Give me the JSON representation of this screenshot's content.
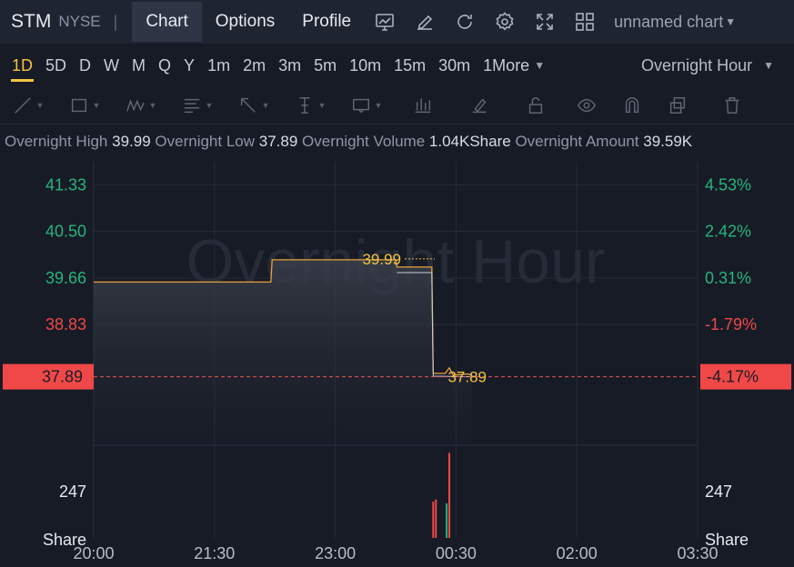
{
  "header": {
    "ticker": "STM",
    "exchange": "NYSE",
    "separator": "|",
    "tabs": [
      {
        "label": "Chart",
        "active": true
      },
      {
        "label": "Options",
        "active": false
      },
      {
        "label": "Profile",
        "active": false
      }
    ],
    "tools": [
      "indicator-icon",
      "draw-pencil-icon",
      "refresh-icon",
      "gear-icon",
      "fullscreen-icon",
      "layout-grid-icon"
    ],
    "chart_name": "unnamed chart"
  },
  "periods": {
    "items": [
      "1D",
      "5D",
      "D",
      "W",
      "M",
      "Q",
      "Y",
      "1m",
      "2m",
      "3m",
      "5m",
      "10m",
      "15m",
      "30m",
      "1More"
    ],
    "active": "1D",
    "session": "Overnight Hour"
  },
  "drawing_tools": [
    "trend-line-icon",
    "rectangle-icon",
    "pattern-icon",
    "fib-icon",
    "arrow-icon",
    "vertical-line-icon",
    "text-note-icon",
    "bars-pattern-icon",
    "brush-icon",
    "lock-icon",
    "eye-icon",
    "magnet-icon",
    "copy-icon",
    "trash-icon"
  ],
  "info": {
    "high_label": "Overnight High",
    "high_value": "39.99",
    "low_label": "Overnight Low",
    "low_value": "37.89",
    "volume_label": "Overnight Volume",
    "volume_value": "1.04KShare",
    "amount_label": "Overnight Amount",
    "amount_value": "39.59K"
  },
  "colors": {
    "up": "#26b57a",
    "down": "#f04848",
    "accent": "#f5c342",
    "line": "#e9a23a"
  },
  "chart_data": {
    "type": "line",
    "watermark": "Overnight Hour",
    "x_ticks": [
      "20:00",
      "21:30",
      "23:00",
      "00:30",
      "02:00",
      "03:30"
    ],
    "price_ticks": [
      {
        "price": "41.33",
        "pct": "4.53%",
        "dir": "up"
      },
      {
        "price": "40.50",
        "pct": "2.42%",
        "dir": "up"
      },
      {
        "price": "39.66",
        "pct": "0.31%",
        "dir": "up"
      },
      {
        "price": "38.83",
        "pct": "-1.79%",
        "dir": "down"
      }
    ],
    "current_price": "37.89",
    "current_pct": "-4.17%",
    "high_label": "39.99",
    "low_label": "37.89",
    "volume_tick": "247",
    "volume_unit": "Share",
    "ylim": [
      36.66,
      41.75
    ],
    "series": [
      {
        "type": "price",
        "points": [
          [
            0,
            39.59
          ],
          [
            132,
            39.59
          ],
          [
            133,
            39.99
          ],
          [
            225,
            39.99
          ],
          [
            226,
            39.86
          ],
          [
            252,
            39.86
          ],
          [
            253,
            37.95
          ],
          [
            262,
            37.95
          ],
          [
            265,
            38.05
          ],
          [
            268,
            37.92
          ],
          [
            279,
            37.94
          ],
          [
            282,
            37.91
          ]
        ]
      },
      {
        "type": "average",
        "points": [
          [
            226,
            39.76
          ],
          [
            252,
            39.76
          ],
          [
            253,
            37.9
          ],
          [
            282,
            37.89
          ]
        ]
      }
    ],
    "volumes": [
      {
        "t": 253,
        "v": 133,
        "dir": "down"
      },
      {
        "t": 255,
        "v": 141,
        "dir": "down"
      },
      {
        "t": 263,
        "v": 127,
        "dir": "up"
      },
      {
        "t": 265,
        "v": 312,
        "dir": "down"
      }
    ],
    "volume_max": 340,
    "x_minutes_total": 450
  }
}
